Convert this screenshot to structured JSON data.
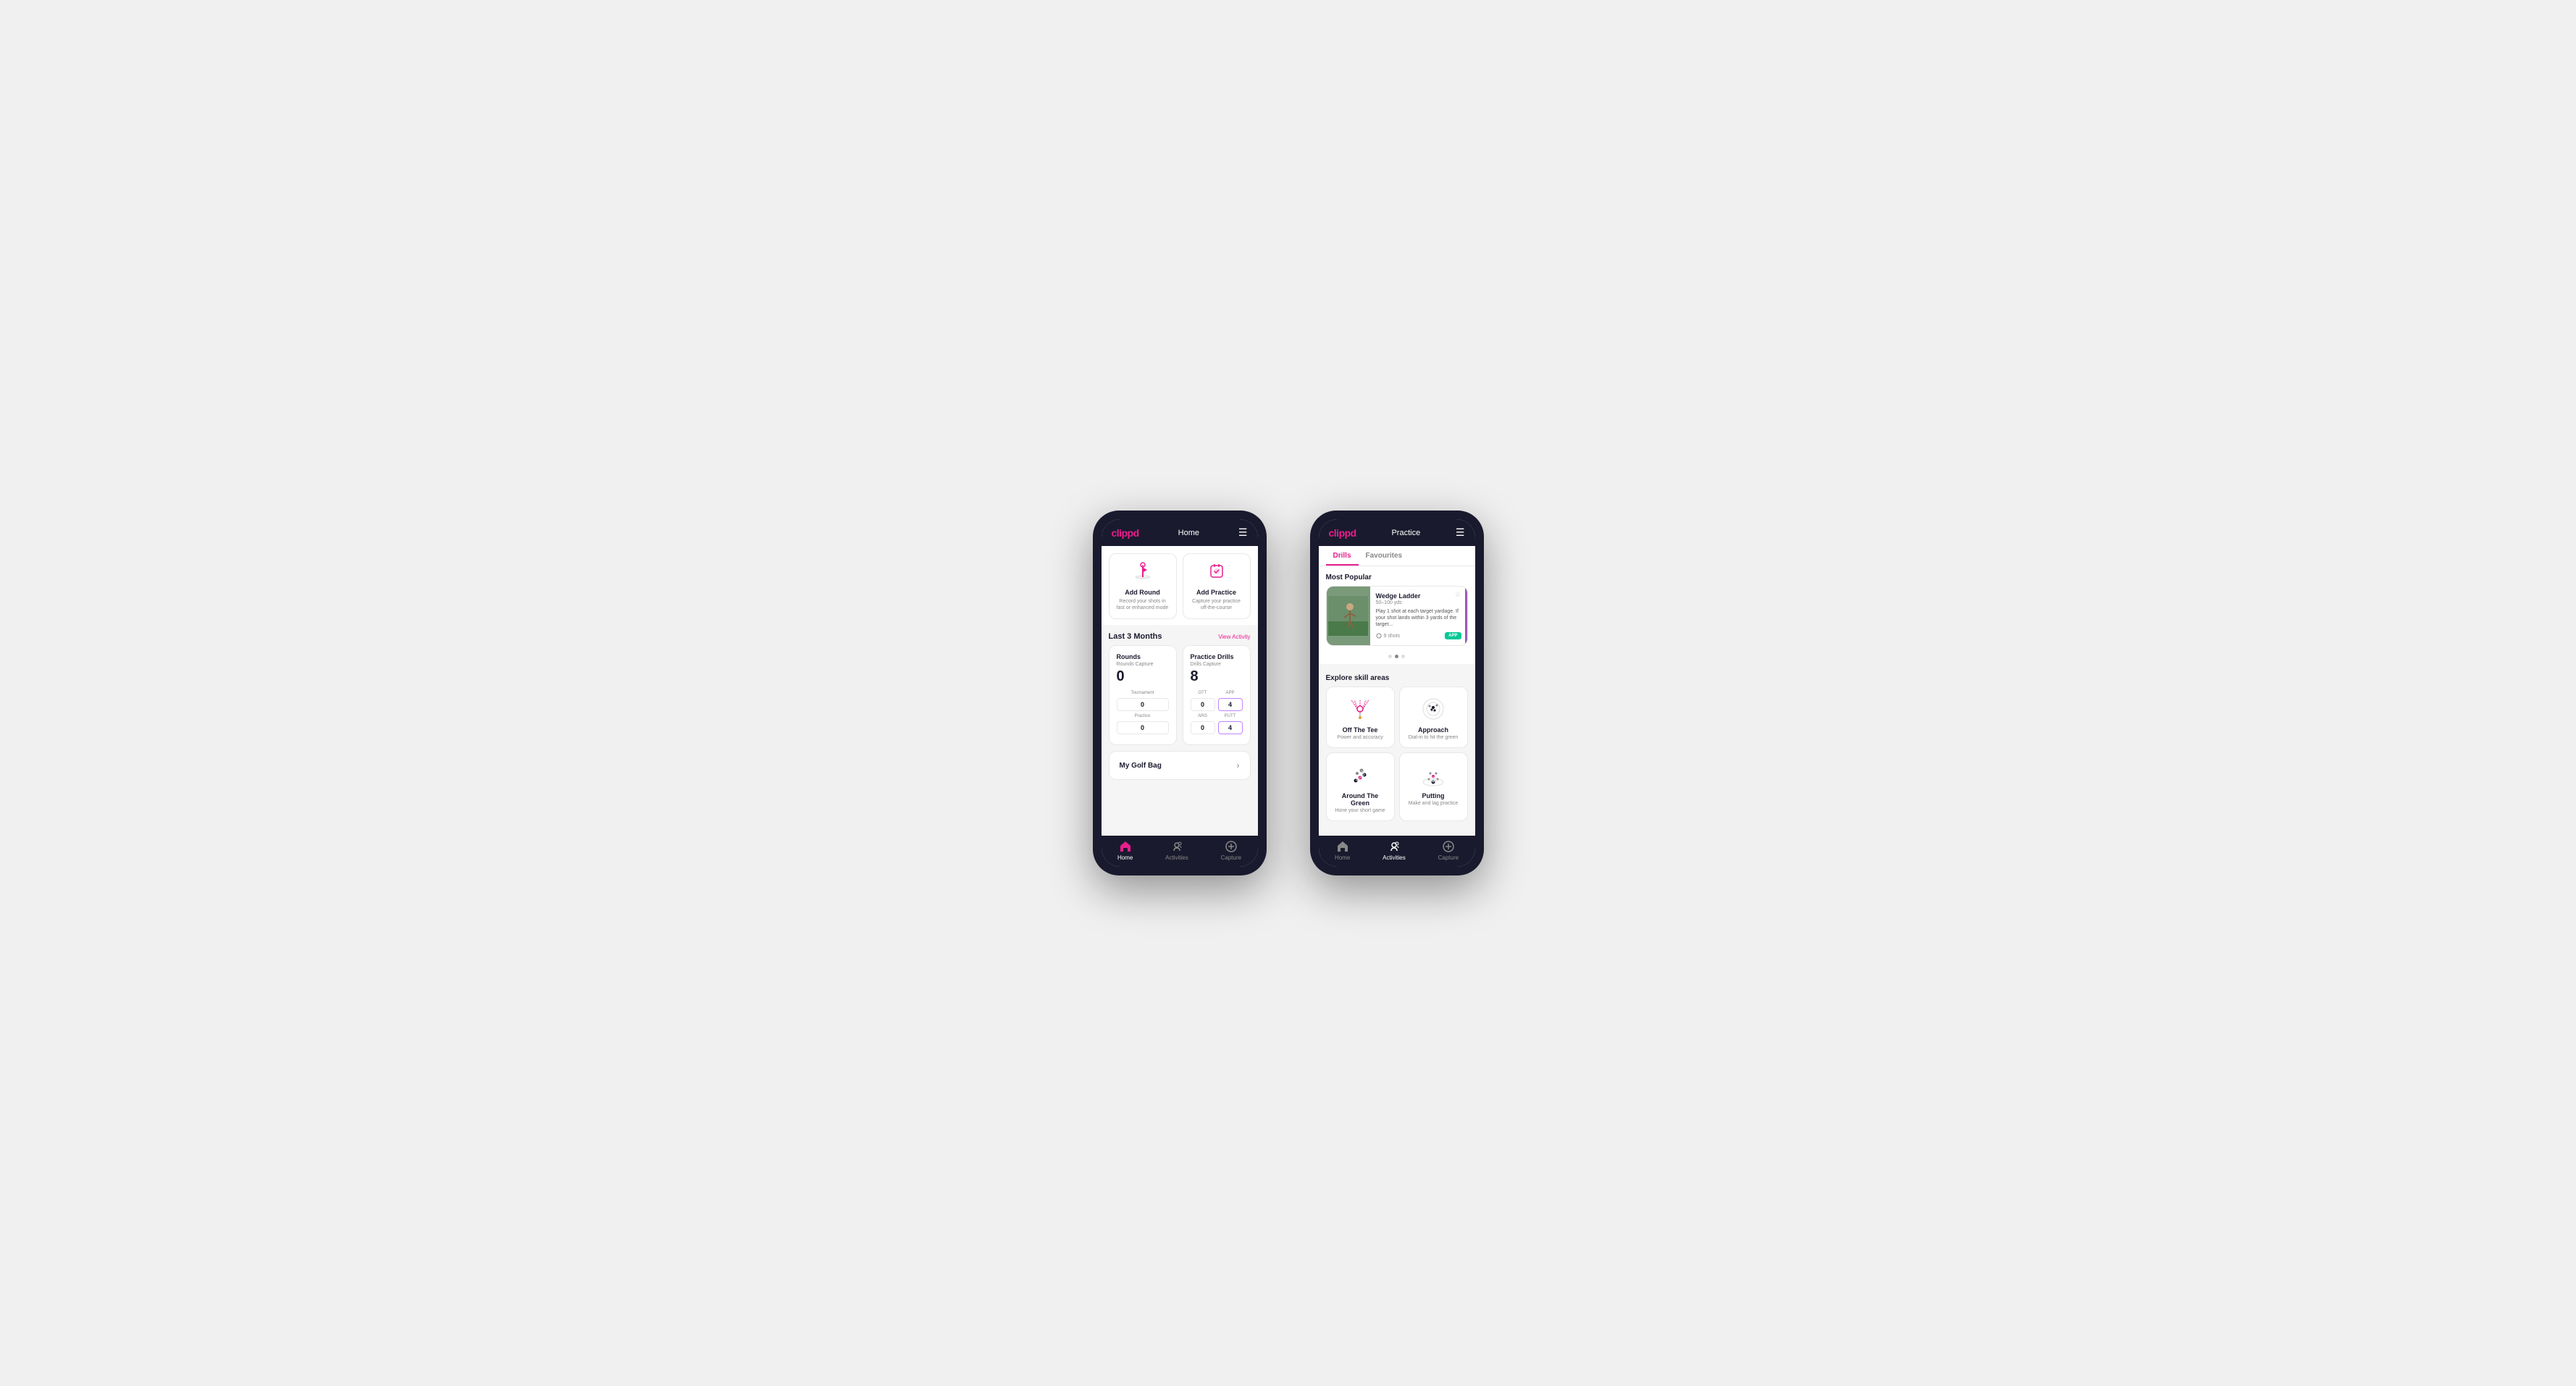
{
  "phone1": {
    "header": {
      "logo": "clippd",
      "title": "Home",
      "menu_icon": "☰"
    },
    "action_cards": [
      {
        "id": "add-round",
        "icon": "⛳",
        "title": "Add Round",
        "description": "Record your shots in fast or enhanced mode"
      },
      {
        "id": "add-practice",
        "icon": "🎯",
        "title": "Add Practice",
        "description": "Capture your practice off-the-course"
      }
    ],
    "activity_section": {
      "title": "Last 3 Months",
      "link": "View Activity"
    },
    "rounds": {
      "title": "Rounds",
      "capture_label": "Rounds Capture",
      "total": "0",
      "rows": [
        {
          "label": "Tournament",
          "value": "0"
        },
        {
          "label": "Practice",
          "value": "0"
        }
      ]
    },
    "practice_drills": {
      "title": "Practice Drills",
      "capture_label": "Drills Capture",
      "total": "8",
      "col1_label": "OTT",
      "col2_label": "APP",
      "col3_label": "ARG",
      "col4_label": "PUTT",
      "col1_val": "0",
      "col2_val": "4",
      "col3_val": "0",
      "col4_val": "4"
    },
    "golf_bag": {
      "label": "My Golf Bag"
    },
    "nav": [
      {
        "icon": "🏠",
        "label": "Home",
        "active": true
      },
      {
        "icon": "⚡",
        "label": "Activities",
        "active": false
      },
      {
        "icon": "➕",
        "label": "Capture",
        "active": false
      }
    ]
  },
  "phone2": {
    "header": {
      "logo": "clippd",
      "title": "Practice",
      "menu_icon": "☰"
    },
    "tabs": [
      {
        "label": "Drills",
        "active": true
      },
      {
        "label": "Favourites",
        "active": false
      }
    ],
    "most_popular": {
      "title": "Most Popular",
      "drill": {
        "title": "Wedge Ladder",
        "subtitle": "50–100 yds",
        "description": "Play 1 shot at each target yardage. If your shot lands within 3 yards of the target...",
        "shots": "9 shots",
        "badge": "APP"
      },
      "dots": [
        false,
        true,
        false
      ]
    },
    "explore": {
      "title": "Explore skill areas",
      "skills": [
        {
          "id": "off-the-tee",
          "name": "Off The Tee",
          "description": "Power and accuracy",
          "icon_type": "tee"
        },
        {
          "id": "approach",
          "name": "Approach",
          "description": "Dial-in to hit the green",
          "icon_type": "approach"
        },
        {
          "id": "around-the-green",
          "name": "Around The Green",
          "description": "Hone your short game",
          "icon_type": "atg"
        },
        {
          "id": "putting",
          "name": "Putting",
          "description": "Make and lag practice",
          "icon_type": "putting"
        }
      ]
    },
    "nav": [
      {
        "icon": "🏠",
        "label": "Home",
        "active": false
      },
      {
        "icon": "⚡",
        "label": "Activities",
        "active": true
      },
      {
        "icon": "➕",
        "label": "Capture",
        "active": false
      }
    ]
  }
}
